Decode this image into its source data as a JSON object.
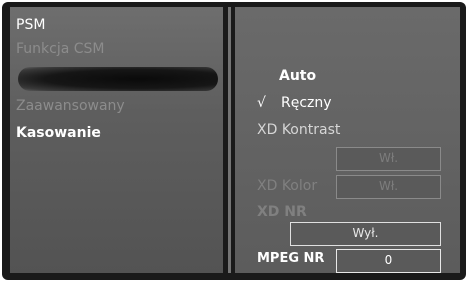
{
  "menu": {
    "psm": "PSM",
    "csm": "Funkcja CSM",
    "advanced": "Zaawansowany",
    "reset": "Kasowanie"
  },
  "options": {
    "auto": "Auto",
    "check_mark": "√",
    "manual": "Ręczny",
    "xd_contrast": "XD Kontrast",
    "xd_contrast_value": "Wł.",
    "xd_color": "XD Kolor",
    "xd_color_value": "Wł.",
    "xd_nr": "XD NR",
    "xd_nr_value": "Wył.",
    "mpeg_nr": "MPEG NR",
    "mpeg_nr_value": "0"
  }
}
